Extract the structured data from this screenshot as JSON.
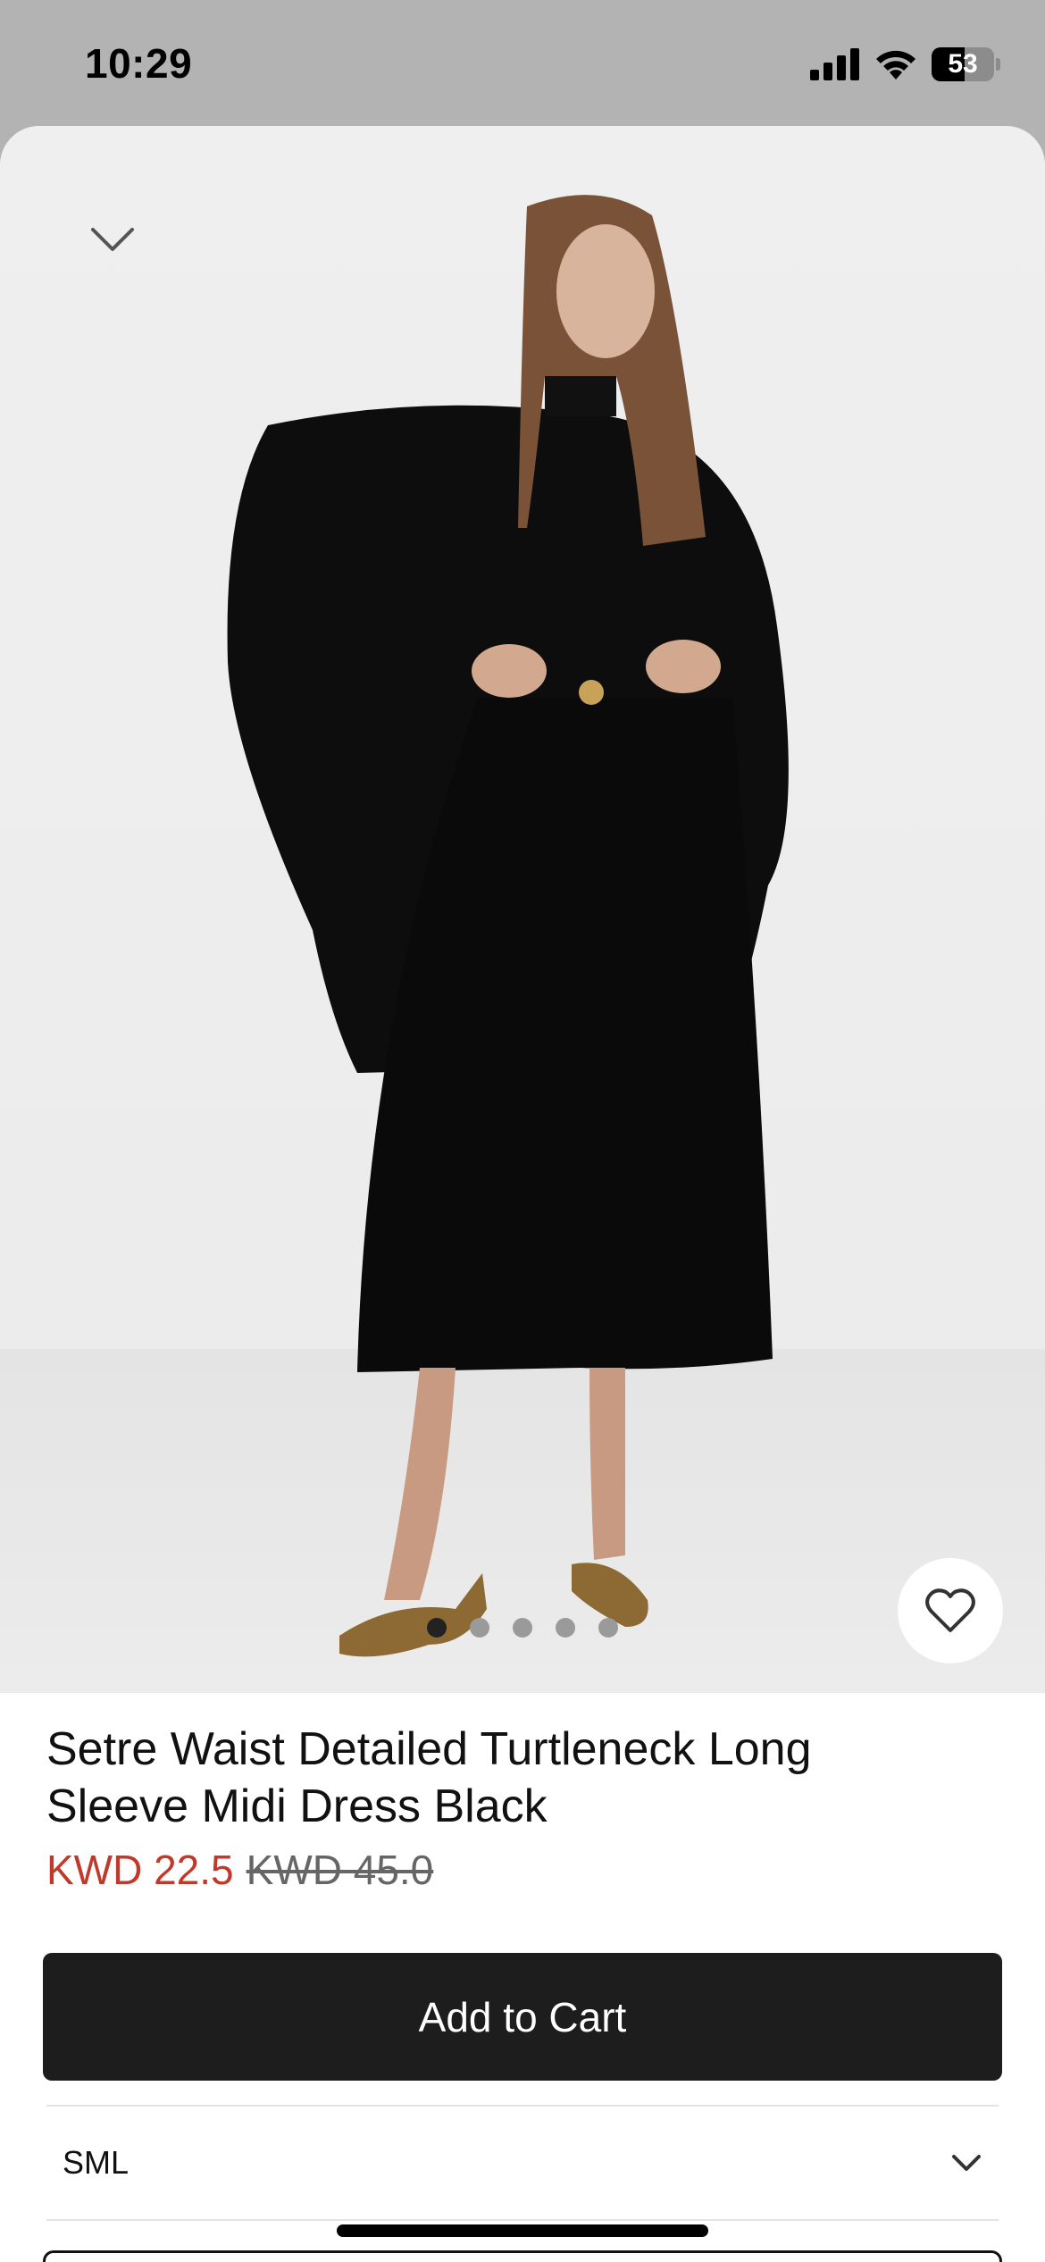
{
  "status_bar": {
    "time": "10:29",
    "battery": "53"
  },
  "product": {
    "title": "Setre Waist Detailed Turtleneck Long Sleeve Midi Dress Black",
    "sale_price": "KWD 22.5",
    "original_price": "KWD 45.0"
  },
  "gallery": {
    "image_count": 5,
    "active_index": 0
  },
  "actions": {
    "add_to_cart": "Add to Cart"
  },
  "size_selector": {
    "value": "SML"
  },
  "colors": {
    "sale": "#c0392b",
    "button": "#1d1d1d"
  }
}
